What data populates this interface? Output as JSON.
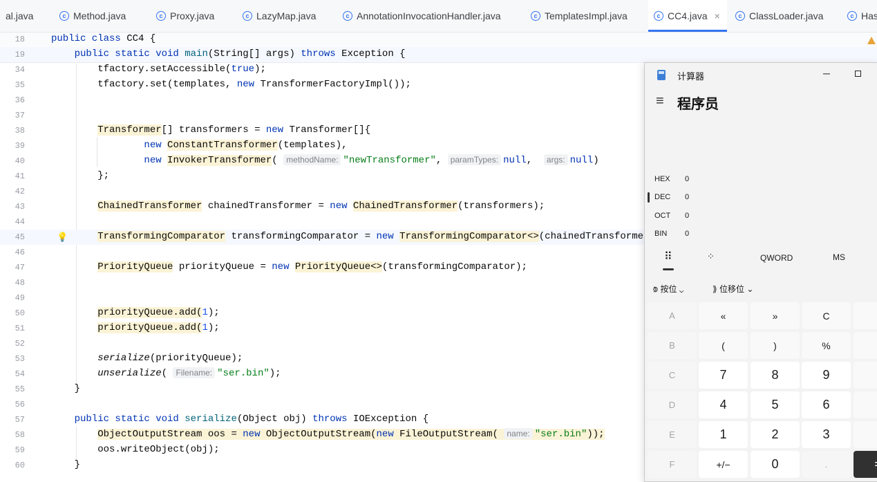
{
  "tabs": [
    {
      "label": "al.java"
    },
    {
      "label": "Method.java"
    },
    {
      "label": "Proxy.java"
    },
    {
      "label": "LazyMap.java"
    },
    {
      "label": "AnnotationInvocationHandler.java"
    },
    {
      "label": "TemplatesImpl.java"
    },
    {
      "label": "CC4.java"
    },
    {
      "label": "ClassLoader.java"
    },
    {
      "label": "Has"
    }
  ],
  "active_tab": "CC4.java",
  "tab_close": "×",
  "line_numbers": [
    "18",
    "19",
    "34",
    "35",
    "36",
    "37",
    "38",
    "39",
    "40",
    "41",
    "42",
    "43",
    "44",
    "45",
    "46",
    "47",
    "48",
    "49",
    "50",
    "51",
    "52",
    "53",
    "54",
    "55",
    "56",
    "57",
    "58",
    "59",
    "60"
  ],
  "hints": {
    "methodName": "methodName:",
    "paramTypes": "paramTypes:",
    "args": "args:",
    "filename_lc": "Filename:",
    "name": "name:"
  },
  "calculator": {
    "title": "计算器",
    "minimize": "─",
    "mode": "程序员",
    "menu_icon": "≡",
    "radix": [
      {
        "label": "HEX",
        "value": "0"
      },
      {
        "label": "DEC",
        "value": "0"
      },
      {
        "label": "OCT",
        "value": "0"
      },
      {
        "label": "BIN",
        "value": "0"
      }
    ],
    "word_size": "QWORD",
    "memory": "MS",
    "bitwise": "按位",
    "bitshift": "位移位",
    "keys": [
      [
        "A",
        "«",
        "»",
        "C"
      ],
      [
        "B",
        "(",
        ")",
        "%"
      ],
      [
        "C",
        "7",
        "8",
        "9"
      ],
      [
        "D",
        "4",
        "5",
        "6"
      ],
      [
        "E",
        "1",
        "2",
        "3"
      ],
      [
        "F",
        "+/−",
        "0",
        "."
      ]
    ],
    "equals": "="
  },
  "colors": {
    "keyword": "#0033b3",
    "string": "#067d17",
    "number": "#1750eb",
    "accent": "#3574f0"
  }
}
